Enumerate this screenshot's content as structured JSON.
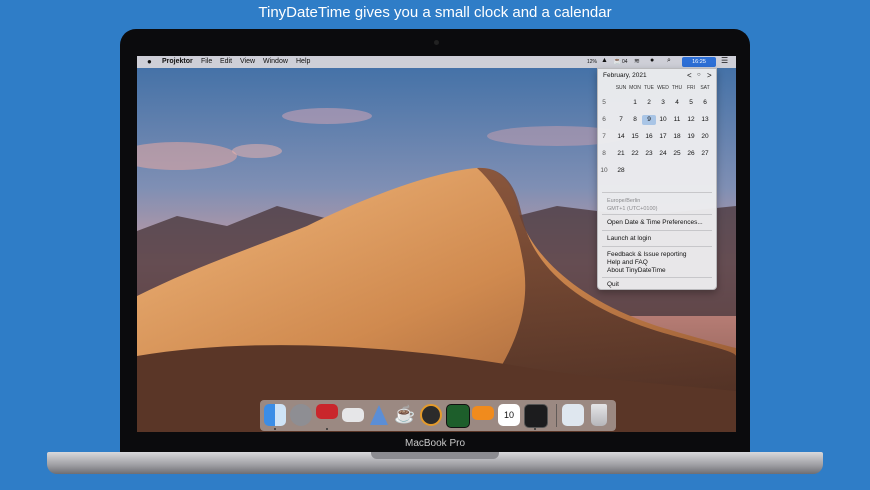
{
  "headline": "TinyDateTime gives you a small clock and a calendar",
  "device_label": "MacBook Pro",
  "menubar": {
    "app_name": "Projektor",
    "items": [
      "File",
      "Edit",
      "View",
      "Window",
      "Help"
    ],
    "status": {
      "battery_text": "12%",
      "cpu_text": "04",
      "clock_text": "16:25"
    }
  },
  "calendar": {
    "month_label": "February, 2021",
    "nav_prev": "<",
    "nav_today": "○",
    "nav_next": ">",
    "day_headers": [
      "SUN",
      "MON",
      "TUE",
      "WED",
      "THU",
      "FRI",
      "SAT"
    ],
    "weeks": [
      {
        "week": "5",
        "days": [
          "",
          "1",
          "2",
          "3",
          "4",
          "5",
          "6"
        ]
      },
      {
        "week": "6",
        "days": [
          "7",
          "8",
          "9",
          "10",
          "11",
          "12",
          "13"
        ]
      },
      {
        "week": "7",
        "days": [
          "14",
          "15",
          "16",
          "17",
          "18",
          "19",
          "20"
        ]
      },
      {
        "week": "8",
        "days": [
          "21",
          "22",
          "23",
          "24",
          "25",
          "26",
          "27"
        ]
      },
      {
        "week": "10",
        "days": [
          "28",
          "",
          "",
          "",
          "",
          "",
          ""
        ]
      }
    ],
    "today": "9"
  },
  "timezone": {
    "line1": "Europe/Berlin",
    "line2": "GMT+1 (UTC+0100)"
  },
  "menu": {
    "open_prefs": "Open Date & Time Preferences...",
    "launch_login": "Launch at login",
    "feedback": "Feedback & Issue reporting",
    "help_faq": "Help and FAQ",
    "about": "About TinyDateTime",
    "quit": "Quit"
  },
  "dock": {
    "calendar_day": "10"
  },
  "colors": {
    "accent": "#2d6fd6",
    "background": "#2f7dc7",
    "today_highlight": "#a9c5e6"
  }
}
